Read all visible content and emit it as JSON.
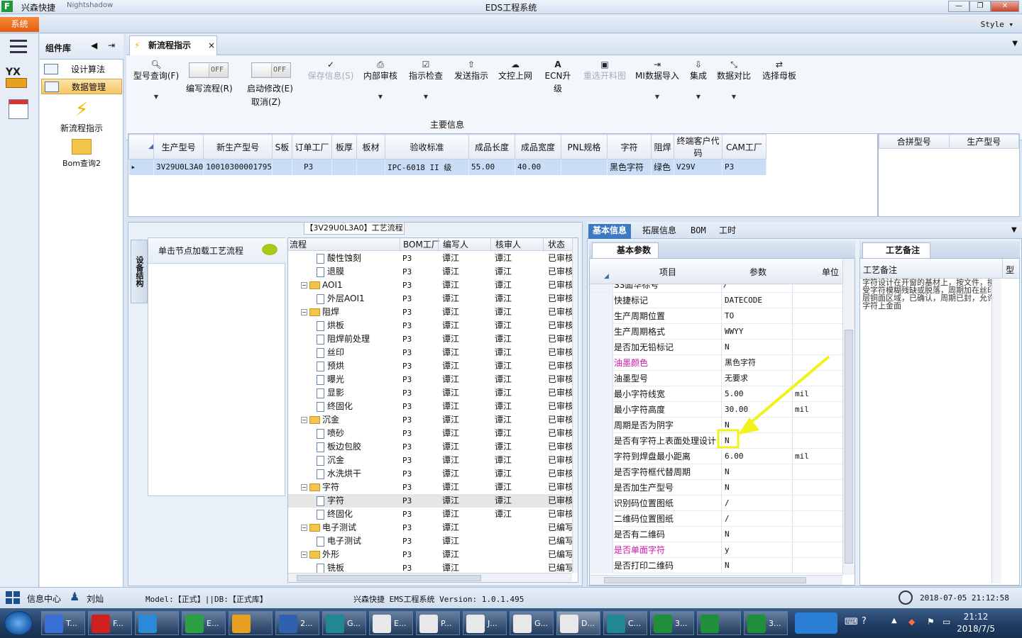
{
  "window": {
    "quick_access": "兴森快捷",
    "quick_access_faded": "Nightshadow",
    "title": "EDS工程系统",
    "style_label": "Style"
  },
  "menu": {
    "system": "系统"
  },
  "component_library": {
    "title": "组件库",
    "items": [
      {
        "label": "设计算法"
      },
      {
        "label": "数据管理"
      }
    ],
    "launchers": [
      {
        "label": "新流程指示"
      },
      {
        "label": "Bom查询2"
      }
    ]
  },
  "tab": {
    "label": "新流程指示"
  },
  "toolbar": {
    "model_query": "型号查询(F)",
    "toggle_off": "OFF",
    "write_flow": "编写流程(R)",
    "start_edit": "启动修改(E)",
    "cancel": "取消(Z)",
    "save_info": "保存信息(S)",
    "internal_review": "内部审核",
    "instruction_check": "指示检查",
    "send_instruction": "发送指示",
    "doc_upload": "文控上网",
    "ecn_upgrade": "ECN升级",
    "reselect_material": "重选开料图",
    "mi_import": "MI数据导入",
    "integrate": "集成",
    "data_compare": "数据对比",
    "select_mother": "选择母板"
  },
  "main_info": {
    "section_title": "主要信息",
    "columns": [
      "生产型号",
      "新生产型号",
      "S板",
      "订单工厂",
      "板厚",
      "板材",
      "验收标准",
      "成品长度",
      "成品宽度",
      "PNL规格",
      "字符",
      "阻焊",
      "终端客户代码",
      "CAM工厂"
    ],
    "row": [
      "3V29U0L3A0",
      "10010300001795",
      "",
      "P3",
      "",
      "",
      "IPC-6018 II 级",
      "55.00",
      "40.00",
      "",
      "黑色字符",
      "绿色",
      "V29V",
      "P3"
    ],
    "side_columns": [
      "合拼型号",
      "生产型号"
    ]
  },
  "flow": {
    "title": "【3V29U0L3A0】工艺流程",
    "side_tab": "设备结构",
    "node_hint": "单击节点加载工艺流程",
    "columns": [
      "流程",
      "BOM工厂",
      "编写人",
      "核审人",
      "状态"
    ],
    "rows": [
      {
        "name": "酸性蚀刻",
        "factory": "P3",
        "writer": "谭江",
        "reviewer": "谭江",
        "status": "已审核",
        "level": 2
      },
      {
        "name": "退膜",
        "factory": "P3",
        "writer": "谭江",
        "reviewer": "谭江",
        "status": "已审核",
        "level": 2
      },
      {
        "name": "AOI1",
        "factory": "P3",
        "writer": "谭江",
        "reviewer": "谭江",
        "status": "已审核",
        "level": 1
      },
      {
        "name": "外层AOI1",
        "factory": "P3",
        "writer": "谭江",
        "reviewer": "谭江",
        "status": "已审核",
        "level": 2
      },
      {
        "name": "阻焊",
        "factory": "P3",
        "writer": "谭江",
        "reviewer": "谭江",
        "status": "已审核",
        "level": 1
      },
      {
        "name": "烘板",
        "factory": "P3",
        "writer": "谭江",
        "reviewer": "谭江",
        "status": "已审核",
        "level": 2
      },
      {
        "name": "阻焊前处理",
        "factory": "P3",
        "writer": "谭江",
        "reviewer": "谭江",
        "status": "已审核",
        "level": 2
      },
      {
        "name": "丝印",
        "factory": "P3",
        "writer": "谭江",
        "reviewer": "谭江",
        "status": "已审核",
        "level": 2
      },
      {
        "name": "预烘",
        "factory": "P3",
        "writer": "谭江",
        "reviewer": "谭江",
        "status": "已审核",
        "level": 2
      },
      {
        "name": "曝光",
        "factory": "P3",
        "writer": "谭江",
        "reviewer": "谭江",
        "status": "已审核",
        "level": 2
      },
      {
        "name": "显影",
        "factory": "P3",
        "writer": "谭江",
        "reviewer": "谭江",
        "status": "已审核",
        "level": 2
      },
      {
        "name": "终固化",
        "factory": "P3",
        "writer": "谭江",
        "reviewer": "谭江",
        "status": "已审核",
        "level": 2
      },
      {
        "name": "沉金",
        "factory": "P3",
        "writer": "谭江",
        "reviewer": "谭江",
        "status": "已审核",
        "level": 1
      },
      {
        "name": "喷砂",
        "factory": "P3",
        "writer": "谭江",
        "reviewer": "谭江",
        "status": "已审核",
        "level": 2
      },
      {
        "name": "板边包胶",
        "factory": "P3",
        "writer": "谭江",
        "reviewer": "谭江",
        "status": "已审核",
        "level": 2
      },
      {
        "name": "沉金",
        "factory": "P3",
        "writer": "谭江",
        "reviewer": "谭江",
        "status": "已审核",
        "level": 2
      },
      {
        "name": "水洗烘干",
        "factory": "P3",
        "writer": "谭江",
        "reviewer": "谭江",
        "status": "已审核",
        "level": 2
      },
      {
        "name": "字符",
        "factory": "P3",
        "writer": "谭江",
        "reviewer": "谭江",
        "status": "已审核",
        "level": 1
      },
      {
        "name": "字符",
        "factory": "P3",
        "writer": "谭江",
        "reviewer": "谭江",
        "status": "已审核",
        "level": 2,
        "selected": true
      },
      {
        "name": "终固化",
        "factory": "P3",
        "writer": "谭江",
        "reviewer": "谭江",
        "status": "已审核",
        "level": 2
      },
      {
        "name": "电子测试",
        "factory": "P3",
        "writer": "谭江",
        "reviewer": "",
        "status": "已编写",
        "level": 1
      },
      {
        "name": "电子测试",
        "factory": "P3",
        "writer": "谭江",
        "reviewer": "",
        "status": "已编写",
        "level": 2
      },
      {
        "name": "外形",
        "factory": "P3",
        "writer": "谭江",
        "reviewer": "",
        "status": "已编写",
        "level": 1
      },
      {
        "name": "铣板",
        "factory": "P3",
        "writer": "谭江",
        "reviewer": "",
        "status": "已编写",
        "level": 2
      }
    ]
  },
  "right_tabs": [
    "基本信息",
    "拓展信息",
    "BOM",
    "工时"
  ],
  "params": {
    "tab": "基本参数",
    "columns": [
      "项目",
      "参数",
      "单位"
    ],
    "partial_top": "SS面华标号",
    "partial_top_value": "/",
    "rows": [
      {
        "k": "快捷标记",
        "v": "DATECODE",
        "u": "",
        "pink": false
      },
      {
        "k": "生产周期位置",
        "v": "TO",
        "u": "",
        "pink": false
      },
      {
        "k": "生产周期格式",
        "v": "WWYY",
        "u": "",
        "pink": false
      },
      {
        "k": "是否加无铅标记",
        "v": "N",
        "u": "",
        "pink": false
      },
      {
        "k": "油墨颜色",
        "v": "黑色字符",
        "u": "",
        "pink": true
      },
      {
        "k": "油墨型号",
        "v": "无要求",
        "u": "",
        "pink": false
      },
      {
        "k": "最小字符线宽",
        "v": "5.00",
        "u": "mil",
        "pink": false
      },
      {
        "k": "最小字符高度",
        "v": "30.00",
        "u": "mil",
        "pink": false
      },
      {
        "k": "周期是否为阴字",
        "v": "N",
        "u": "",
        "pink": false
      },
      {
        "k": "是否有字符上表面处理设计",
        "v": "N",
        "u": "",
        "pink": false,
        "highlight": true
      },
      {
        "k": "字符到焊盘最小距离",
        "v": "6.00",
        "u": "mil",
        "pink": false
      },
      {
        "k": "是否字符框代替周期",
        "v": "N",
        "u": "",
        "pink": false
      },
      {
        "k": "是否加生产型号",
        "v": "N",
        "u": "",
        "pink": false
      },
      {
        "k": "识别码位置图纸",
        "v": "/",
        "u": "",
        "pink": false
      },
      {
        "k": "二维码位置图纸",
        "v": "/",
        "u": "",
        "pink": false
      },
      {
        "k": "是否有二维码",
        "v": "N",
        "u": "",
        "pink": false
      },
      {
        "k": "是否单面字符",
        "v": "y",
        "u": "",
        "pink": true
      },
      {
        "k": "是否打印二维码",
        "v": "N",
        "u": "",
        "pink": false
      }
    ]
  },
  "notes": {
    "tab": "工艺备注",
    "col1": "工艺备注",
    "col2": "型",
    "text": "字符设计在开窗的基材上，按文件，接受字符模糊残缺或脱落，周期加在丝印层铜面区域，已确认，周期已封，允许字符上金面"
  },
  "status": {
    "info_center": "信息中心",
    "user": "刘灿",
    "model": "Model:【正式】||DB:【正式库】",
    "version": "兴森快捷 EMS工程系统 Version: 1.0.1.495",
    "datetime": "2018-07-05 21:12:58"
  },
  "taskbar": {
    "buttons": [
      "T...",
      "F...",
      "",
      "E...",
      "",
      "2...",
      "G...",
      "E...",
      "P...",
      "J...",
      "G...",
      "D...",
      "C...",
      "3...",
      "",
      "3..."
    ],
    "time": "21:12",
    "date": "2018/7/5"
  }
}
